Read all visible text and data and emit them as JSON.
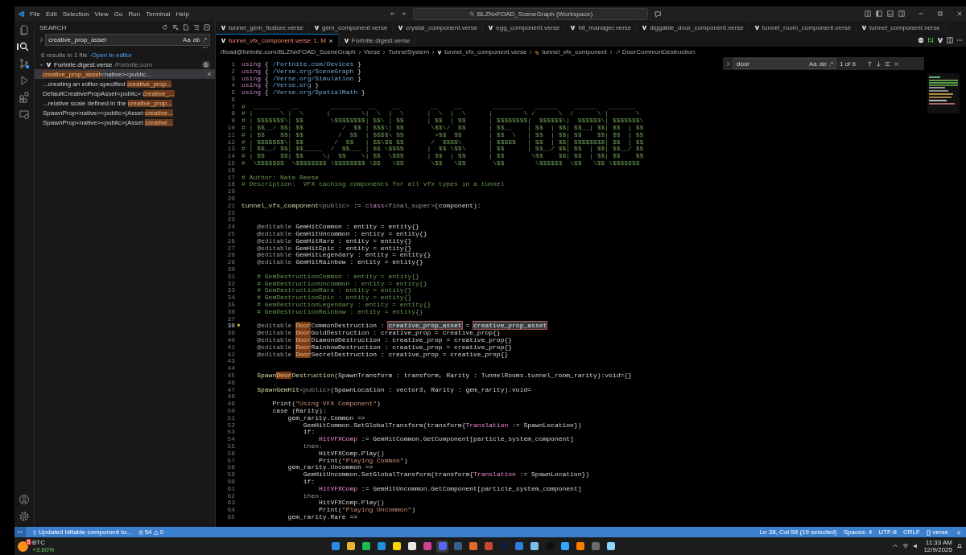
{
  "window": {
    "title": "BLZNxFOAD_SceneGraph (Workspace)"
  },
  "menu": [
    "File",
    "Edit",
    "Selection",
    "View",
    "Go",
    "Run",
    "Terminal",
    "Help"
  ],
  "activity_bar": [
    {
      "kind": "files",
      "selected": false
    },
    {
      "kind": "search",
      "selected": true
    },
    {
      "kind": "source-control",
      "selected": false
    },
    {
      "kind": "run",
      "selected": false
    },
    {
      "kind": "extensions",
      "selected": false
    },
    {
      "kind": "remote",
      "selected": false
    }
  ],
  "activity_bottom": [
    {
      "kind": "account"
    },
    {
      "kind": "settings"
    }
  ],
  "sidebar": {
    "title": "SEARCH",
    "query": "creative_prop_asset",
    "options": [
      "Aa",
      "ab",
      ".*"
    ],
    "summary": "6 results in 1 file - ",
    "summary_link": "Open in editor",
    "file": {
      "name": "Fortnite.digest.verse",
      "path": "/Fortnite.com",
      "count": "6",
      "expanded": true
    },
    "results": [
      {
        "match": "creative_prop_asset",
        "after": "<native><public...",
        "selected": true
      },
      {
        "before": "...creating an editor-specified ",
        "match": "creative_prop...",
        "selected": false
      },
      {
        "before": "DefaultCreativePropAsset<public>:",
        "match": "creative_...",
        "selected": false
      },
      {
        "before": "...relative scale defined in the ",
        "match": "creative_prop...",
        "selected": false
      },
      {
        "before": "SpawnProp<native><public>(Asset:",
        "match": "creative...",
        "selected": false
      },
      {
        "before": "SpawnProp<native><public>(Asset:",
        "match": "creative...",
        "selected": false
      }
    ]
  },
  "tabs": [
    {
      "label": "tunnel_gem_feature.verse",
      "selected": false
    },
    {
      "label": "gem_component.verse",
      "selected": false
    },
    {
      "label": "crystal_component.verse",
      "selected": false
    },
    {
      "label": "egg_component.verse",
      "selected": false
    },
    {
      "label": "hit_manager.verse",
      "selected": false
    },
    {
      "label": "diggable_door_component.verse",
      "selected": false
    },
    {
      "label": "tunnel_room_component.verse",
      "selected": false
    },
    {
      "label": "tunnel_component.verse",
      "selected": false
    },
    {
      "label": "tunnel_vfx_component.verse",
      "badge": "1, M",
      "selected": true
    },
    {
      "label": "Fortnite.digest.verse",
      "selected": false
    }
  ],
  "breadcrumb": [
    "/fload@fortnite.com/BLZNxFOAD_SceneGraph",
    "Verse",
    "TunnelSystem",
    "tunnel_vfx_component.verse",
    "tunnel_vfx_component",
    "DoorCommonDestruction"
  ],
  "find": {
    "value": "door",
    "options": [
      "Aa",
      "ab",
      ".*"
    ],
    "count": "1 of 6"
  },
  "code": [
    {
      "n": "1",
      "parts": [
        {
          "kind": "kw",
          "text": "using"
        },
        {
          "kind": "plain",
          "text": " { "
        },
        {
          "kind": "path",
          "text": "/Fortnite.com/Devices"
        },
        {
          "kind": "plain",
          "text": " }"
        }
      ]
    },
    {
      "n": "2",
      "parts": [
        {
          "kind": "kw",
          "text": "using"
        },
        {
          "kind": "plain",
          "text": " { "
        },
        {
          "kind": "path",
          "text": "/Verse.org/SceneGraph"
        },
        {
          "kind": "plain",
          "text": " }"
        }
      ]
    },
    {
      "n": "3",
      "parts": [
        {
          "kind": "kw",
          "text": "using"
        },
        {
          "kind": "plain",
          "text": " { "
        },
        {
          "kind": "path",
          "text": "/Verse.org/Simulation"
        },
        {
          "kind": "plain",
          "text": " }"
        }
      ]
    },
    {
      "n": "4",
      "parts": [
        {
          "kind": "kw",
          "text": "using"
        },
        {
          "kind": "plain",
          "text": " { "
        },
        {
          "kind": "path",
          "text": "/Verse.org"
        },
        {
          "kind": "plain",
          "text": " }"
        }
      ]
    },
    {
      "n": "5",
      "parts": [
        {
          "kind": "kw",
          "text": "using"
        },
        {
          "kind": "plain",
          "text": " { "
        },
        {
          "kind": "path",
          "text": "/Verse.org/SpatialMath"
        },
        {
          "kind": "plain",
          "text": " }"
        }
      ]
    },
    {
      "n": "6"
    },
    {
      "n": "7",
      "parts": [
        {
          "kind": "comment",
          "text": "#  _______   __        ________  __    __        __    __        ________   ______    ______   _______"
        }
      ]
    },
    {
      "n": "8",
      "parts": [
        {
          "kind": "comment",
          "text": "# |       \\ |  \\      |        \\|  \\  |  \\      |  \\  |  \\      |        \\ /      \\  /      \\ |       \\"
        }
      ]
    },
    {
      "n": "9",
      "parts": [
        {
          "kind": "comment",
          "text": "# | $$$$$$$\\| $$       \\$$$$$$$$| $$\\ | $$      | $$  | $$      | $$$$$$$$|  $$$$$$\\|  $$$$$$\\| $$$$$$$\\"
        }
      ]
    },
    {
      "n": "10",
      "parts": [
        {
          "kind": "comment",
          "text": "# | $$__/ $$| $$          /  $$ | $$$\\| $$       \\$$\\/  $$      | $$__    | $$  | $$| $$__| $$| $$  | $$"
        }
      ]
    },
    {
      "n": "11",
      "parts": [
        {
          "kind": "comment",
          "text": "# | $$    $$| $$         /  $$  | $$$$\\ $$        >$$  $$       | $$  \\   | $$  | $$| $$    $$| $$  | $$"
        }
      ]
    },
    {
      "n": "12",
      "parts": [
        {
          "kind": "comment",
          "text": "# | $$$$$$$\\| $$        /  $$   | $$\\$$ $$       /  $$$$\\       | $$$$$   | $$  | $$| $$$$$$$$| $$  | $$"
        }
      ]
    },
    {
      "n": "13",
      "parts": [
        {
          "kind": "comment",
          "text": "# | $$__/ $$| $$_____  /  $$___ | $$ \\$$$$      |  $$ \\$$\\      | $$      | $$__/ $$| $$  | $$| $$__/ $$"
        }
      ]
    },
    {
      "n": "14",
      "parts": [
        {
          "kind": "comment",
          "text": "# | $$    $$| $$     \\|  $$    \\| $$  \\$$$      | $$  | $$      | $$       \\$$    $$| $$  | $$| $$    $$"
        }
      ]
    },
    {
      "n": "15",
      "parts": [
        {
          "kind": "comment",
          "text": "#  \\$$$$$$$  \\$$$$$$$$ \\$$$$$$$$ \\$$   \\$$       \\$$   \\$$       \\$$        \\$$$$$$  \\$$   \\$$ \\$$$$$$$"
        }
      ]
    },
    {
      "n": "16"
    },
    {
      "n": "17",
      "parts": [
        {
          "kind": "comment",
          "text": "# Author: Nate Reese"
        }
      ]
    },
    {
      "n": "18",
      "parts": [
        {
          "kind": "comment",
          "text": "# Description:  VFX caching components for all vfx types in a tunnel"
        }
      ]
    },
    {
      "n": "19"
    },
    {
      "n": "20"
    },
    {
      "n": "21",
      "parts": [
        {
          "kind": "type",
          "text": "tunnel_vfx_component"
        },
        {
          "kind": "dim",
          "text": "<public>"
        },
        {
          "kind": "plain",
          "text": " := "
        },
        {
          "kind": "kw",
          "text": "class"
        },
        {
          "kind": "dim",
          "text": "<final_super>"
        },
        {
          "kind": "plain",
          "text": "(component):"
        }
      ]
    },
    {
      "n": "22"
    },
    {
      "n": "23"
    },
    {
      "n": "24",
      "parts": [
        {
          "kind": "dim",
          "text": "    @editable "
        },
        {
          "kind": "plain",
          "text": "GemHitCommon : entity = entity{}"
        }
      ]
    },
    {
      "n": "25",
      "parts": [
        {
          "kind": "dim",
          "text": "    @editable "
        },
        {
          "kind": "plain",
          "text": "GemHitUncommon : entity = entity{}"
        }
      ]
    },
    {
      "n": "26",
      "parts": [
        {
          "kind": "dim",
          "text": "    @editable "
        },
        {
          "kind": "plain",
          "text": "GemHitRare : entity = entity{}"
        }
      ]
    },
    {
      "n": "27",
      "parts": [
        {
          "kind": "dim",
          "text": "    @editable "
        },
        {
          "kind": "plain",
          "text": "GemHitEpic : entity = entity{}"
        }
      ]
    },
    {
      "n": "28",
      "parts": [
        {
          "kind": "dim",
          "text": "    @editable "
        },
        {
          "kind": "plain",
          "text": "GemHitLegendary : entity = entity{}"
        }
      ]
    },
    {
      "n": "29",
      "parts": [
        {
          "kind": "dim",
          "text": "    @editable "
        },
        {
          "kind": "plain",
          "text": "GemHitRainbow : entity = entity{}"
        }
      ]
    },
    {
      "n": "30"
    },
    {
      "n": "31",
      "parts": [
        {
          "kind": "comment",
          "text": "    # GemDestructionCommon : entity = entity{}"
        }
      ]
    },
    {
      "n": "32",
      "parts": [
        {
          "kind": "comment",
          "text": "    # GemDestructionUncommon : entity = entity{}"
        }
      ]
    },
    {
      "n": "33",
      "parts": [
        {
          "kind": "comment",
          "text": "    # GemDestructionRare : entity = entity{}"
        }
      ]
    },
    {
      "n": "34",
      "parts": [
        {
          "kind": "comment",
          "text": "    # GemDestructionEpic : entity = entity{}"
        }
      ]
    },
    {
      "n": "35",
      "parts": [
        {
          "kind": "comment",
          "text": "    # GemDestructionLegendary : entity = entity{}"
        }
      ]
    },
    {
      "n": "36",
      "parts": [
        {
          "kind": "comment",
          "text": "    # GemDestructionRainbow : entity = entity{}"
        }
      ]
    },
    {
      "n": "37"
    },
    {
      "n": "38",
      "lightbulb": true,
      "parts": [
        {
          "kind": "dim",
          "text": "    @editable "
        },
        {
          "kind": "match",
          "text": "Door"
        },
        {
          "kind": "plain",
          "text": "CommonDestruction : "
        },
        {
          "kind": "selection",
          "text": "creative_prop_asset"
        },
        {
          "kind": "plain",
          "text": " = "
        },
        {
          "kind": "selection",
          "text": "creative_prop_asset"
        }
      ]
    },
    {
      "n": "39",
      "parts": [
        {
          "kind": "dim",
          "text": "    @editable "
        },
        {
          "kind": "match",
          "text": "Door"
        },
        {
          "kind": "plain",
          "text": "GoldDestruction : creative_prop = creative_prop{}"
        }
      ]
    },
    {
      "n": "40",
      "parts": [
        {
          "kind": "dim",
          "text": "    @editable "
        },
        {
          "kind": "match",
          "text": "Door"
        },
        {
          "kind": "plain",
          "text": "DiamondDestruction : creative_prop = creative_prop{}"
        }
      ]
    },
    {
      "n": "41",
      "parts": [
        {
          "kind": "dim",
          "text": "    @editable "
        },
        {
          "kind": "match",
          "text": "Door"
        },
        {
          "kind": "plain",
          "text": "RainbowDestruction : creative_prop = creative_prop{}"
        }
      ]
    },
    {
      "n": "42",
      "parts": [
        {
          "kind": "dim",
          "text": "    @editable "
        },
        {
          "kind": "match",
          "text": "Door"
        },
        {
          "kind": "plain",
          "text": "SecretDestruction : creative_prop = creative_prop{}"
        }
      ]
    },
    {
      "n": "43"
    },
    {
      "n": "44"
    },
    {
      "n": "45",
      "parts": [
        {
          "kind": "type",
          "text": "    Spawn"
        },
        {
          "kind": "match",
          "text": "Door"
        },
        {
          "kind": "type",
          "text": "Destruction"
        },
        {
          "kind": "plain",
          "text": "(SpawnTransform : transform, Rarity : TunnelRooms.tunnel_room_rarity):void={}"
        }
      ]
    },
    {
      "n": "46"
    },
    {
      "n": "47",
      "parts": [
        {
          "kind": "type",
          "text": "    SpawnGemHit"
        },
        {
          "kind": "dim",
          "text": "<public>"
        },
        {
          "kind": "plain",
          "text": "(SpawnLocation : vector3, Rarity : gem_rarity):void="
        }
      ]
    },
    {
      "n": "48"
    },
    {
      "n": "49",
      "parts": [
        {
          "kind": "plain",
          "text": "        Print("
        },
        {
          "kind": "string",
          "text": "\"Using VFX Component\""
        },
        {
          "kind": "plain",
          "text": ")"
        }
      ]
    },
    {
      "n": "50",
      "parts": [
        {
          "kind": "plain",
          "text": "        case (Rarity):"
        }
      ]
    },
    {
      "n": "51",
      "parts": [
        {
          "kind": "plain",
          "text": "            gem_rarity.Common =>"
        }
      ]
    },
    {
      "n": "52",
      "parts": [
        {
          "kind": "plain",
          "text": "                GemHitCommon.SetGlobalTransform(transform{"
        },
        {
          "kind": "var",
          "text": "Translation"
        },
        {
          "kind": "plain",
          "text": " := SpawnLocation})"
        }
      ]
    },
    {
      "n": "53",
      "parts": [
        {
          "kind": "plain",
          "text": "                if:"
        }
      ]
    },
    {
      "n": "54",
      "parts": [
        {
          "kind": "var",
          "text": "                    HitVFXComp"
        },
        {
          "kind": "plain",
          "text": " := GemHitCommon.GetComponent[particle_system_component]"
        }
      ]
    },
    {
      "n": "55",
      "parts": [
        {
          "kind": "dim",
          "text": "                then:"
        }
      ]
    },
    {
      "n": "56",
      "parts": [
        {
          "kind": "plain",
          "text": "                    HitVFXComp.Play()"
        }
      ]
    },
    {
      "n": "57",
      "parts": [
        {
          "kind": "plain",
          "text": "                    Print("
        },
        {
          "kind": "string",
          "text": "\"Playing Common\""
        },
        {
          "kind": "plain",
          "text": ")"
        }
      ]
    },
    {
      "n": "58",
      "parts": [
        {
          "kind": "plain",
          "text": "            gem_rarity.Uncommon =>"
        }
      ]
    },
    {
      "n": "59",
      "parts": [
        {
          "kind": "plain",
          "text": "                GemHitUncommon.SetGlobalTransform(transform{"
        },
        {
          "kind": "var",
          "text": "Translation"
        },
        {
          "kind": "plain",
          "text": " := SpawnLocation})"
        }
      ]
    },
    {
      "n": "60",
      "parts": [
        {
          "kind": "plain",
          "text": "                if:"
        }
      ]
    },
    {
      "n": "61",
      "parts": [
        {
          "kind": "var",
          "text": "                    HitVFXComp"
        },
        {
          "kind": "plain",
          "text": " := GemHitUncommon.GetComponent[particle_system_component]"
        }
      ]
    },
    {
      "n": "62",
      "parts": [
        {
          "kind": "dim",
          "text": "                then:"
        }
      ]
    },
    {
      "n": "63",
      "parts": [
        {
          "kind": "plain",
          "text": "                    HitVFXComp.Play()"
        }
      ]
    },
    {
      "n": "64",
      "parts": [
        {
          "kind": "plain",
          "text": "                    Print("
        },
        {
          "kind": "string",
          "text": "\"Playing Uncommon\""
        },
        {
          "kind": "plain",
          "text": ")"
        }
      ]
    },
    {
      "n": "65",
      "parts": [
        {
          "kind": "plain",
          "text": "            gem_rarity.Rare =>"
        }
      ]
    }
  ],
  "status_bar": {
    "message": "Updated hittable component to...",
    "errors": "54",
    "warnings": "0",
    "right": [
      "Ln 38, Col 58 (19 selected)",
      "Spaces: 4",
      "UTF-8",
      "CRLF",
      "{} verse"
    ]
  },
  "taskbar": {
    "ticker": {
      "name": "BTC",
      "change": "+3.60%",
      "badge": "5"
    },
    "apps": [
      {
        "color": "#2b8de0",
        "selected": false
      },
      {
        "color": "#e8b530",
        "selected": false
      },
      {
        "color": "#1db954",
        "selected": false
      },
      {
        "color": "#1e8fd6",
        "selected": false
      },
      {
        "color": "#f5d50a",
        "selected": false
      },
      {
        "color": "#e8e8e8",
        "selected": false
      },
      {
        "color": "#d04090",
        "selected": false
      },
      {
        "color": "#5865f2",
        "selected": true
      },
      {
        "color": "#3a5f8a",
        "selected": false
      },
      {
        "color": "#e06a2a",
        "selected": false
      },
      {
        "color": "#c74634",
        "selected": false
      },
      {
        "color": "#0f1f3a",
        "selected": false
      },
      {
        "color": "#2f7ed8",
        "selected": false
      },
      {
        "color": "#7ac0e8",
        "selected": false
      },
      {
        "color": "#101010",
        "selected": false
      },
      {
        "color": "#31a8ff",
        "selected": false
      },
      {
        "color": "#ff7c00",
        "selected": false
      },
      {
        "color": "#6a6a6a",
        "selected": false
      },
      {
        "color": "#8fd3ff",
        "selected": false
      }
    ],
    "time": "11:33 AM",
    "date": "12/9/2025"
  }
}
